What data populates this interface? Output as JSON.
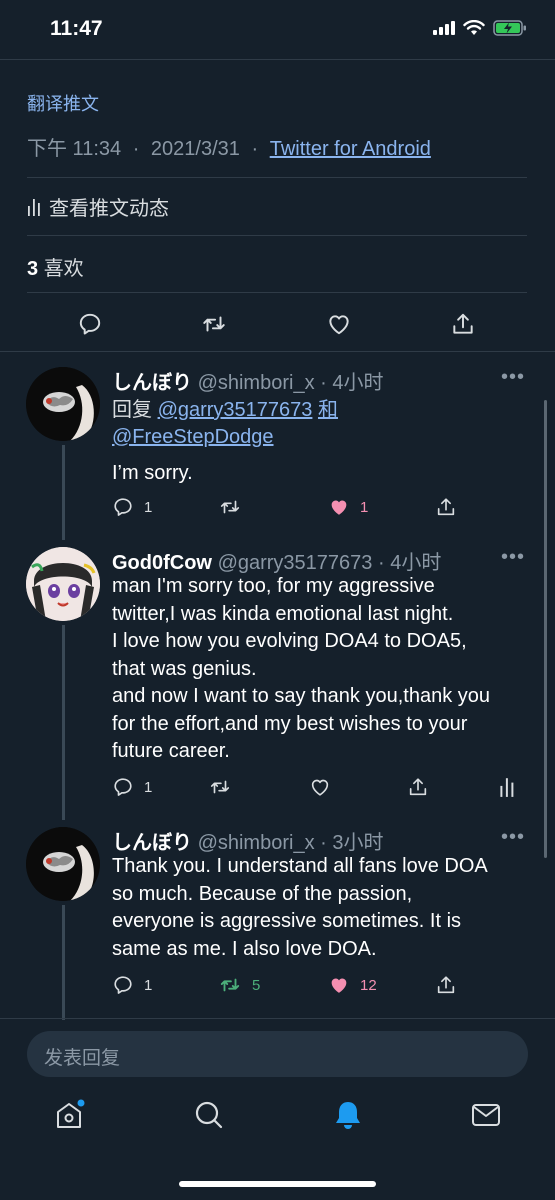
{
  "status_bar": {
    "time": "11:47"
  },
  "tweet": {
    "translate_label": "翻译推文",
    "time": "下午 11:34",
    "date": "2021/3/31",
    "separator": "·",
    "source": "Twitter for Android",
    "activity_label": "查看推文动态",
    "likes_count": "3",
    "likes_label": "喜欢"
  },
  "replies": [
    {
      "name": "しんぼり",
      "handle": "@shimbori_x",
      "time": "· 4小时",
      "reply_prefix": "回复",
      "reply_to_1": "@garry35177673",
      "reply_and": "和",
      "reply_to_2": "@FreeStepDodge",
      "text": "I’m sorry.",
      "reply_count": "1",
      "retweet_count": "",
      "like_count": "1",
      "liked": true
    },
    {
      "name": "God0fCow",
      "handle": "@garry35177673",
      "time": "· 4小时",
      "text_lines": [
        "man I'm sorry too, for my aggressive",
        "twitter,I was kinda emotional last night.",
        "I love how you evolving DOA4 to DOA5,",
        "that was genius.",
        "and now I want to say thank you,thank you",
        "for the effort,and my best wishes to your",
        "future career."
      ],
      "reply_count": "1",
      "retweet_count": "",
      "like_count": "",
      "liked": false
    },
    {
      "name": "しんぼり",
      "handle": "@shimbori_x",
      "time": "· 3小时",
      "text_lines": [
        "Thank you. I understand all fans love DOA",
        "so much. Because of the passion,",
        "everyone is aggressive sometimes. It is",
        "same as me. I also love DOA."
      ],
      "reply_count": "1",
      "retweet_count": "5",
      "like_count": "12",
      "liked": true,
      "retweeted": true
    }
  ],
  "more_label": "•••",
  "compose": {
    "placeholder": "发表回复"
  },
  "colors": {
    "background": "#15202b",
    "link": "#8ab4ee",
    "muted": "#8b98a5",
    "like_pink": "#f48fb1",
    "retweet_green": "#4caf7a",
    "notification_blue": "#1d9bf0"
  },
  "icons": {
    "actions": [
      "reply-icon",
      "retweet-icon",
      "like-icon",
      "share-icon"
    ],
    "nav": [
      "home-icon",
      "search-icon",
      "notifications-icon",
      "messages-icon"
    ]
  }
}
